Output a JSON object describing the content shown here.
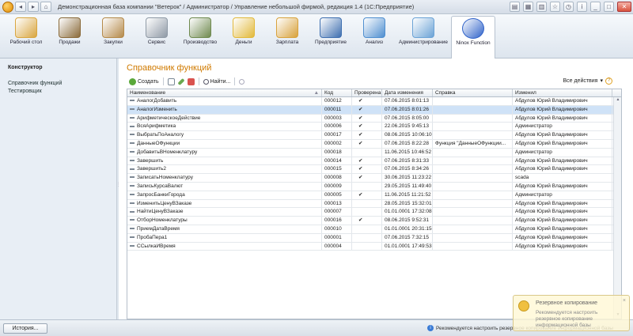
{
  "window": {
    "title": "Демонстрационная база компании \"Ветерок\" / Администратор / Управление небольшой фирмой, редакция 1.4  (1С:Предприятие)"
  },
  "sections": [
    {
      "label": "Рабочий стол",
      "icon": "desktop-icon",
      "color": "#d9a640"
    },
    {
      "label": "Продажи",
      "icon": "sales-icon",
      "color": "#8a6a3a"
    },
    {
      "label": "Закупки",
      "icon": "purchases-icon",
      "color": "#b58a4a"
    },
    {
      "label": "Сервис",
      "icon": "service-icon",
      "color": "#8f9aa6"
    },
    {
      "label": "Производство",
      "icon": "production-icon",
      "color": "#6f8a4f"
    },
    {
      "label": "Деньги",
      "icon": "money-icon",
      "color": "#e2b93b"
    },
    {
      "label": "Зарплата",
      "icon": "salary-icon",
      "color": "#d8a23c"
    },
    {
      "label": "Предприятие",
      "icon": "enterprise-icon",
      "color": "#3e6fb0"
    },
    {
      "label": "Анализ",
      "icon": "analysis-icon",
      "color": "#4f8fd0"
    },
    {
      "label": "Администрирование",
      "icon": "administration-icon",
      "color": "#6ba3d6"
    },
    {
      "label": "Ninox Function",
      "icon": "ninox-icon",
      "color": "#2f62c9"
    }
  ],
  "left_panel": {
    "heading": "Конструктор",
    "links": [
      "Справочник функций",
      "Тестировщик"
    ]
  },
  "form": {
    "title": "Справочник функций",
    "toolbar": {
      "create": "Создать",
      "find": "Найти...",
      "all_actions": "Все действия",
      "help": "?"
    },
    "columns": [
      "Наименование",
      "Код",
      "Проверена",
      "Дата изменения",
      "Справка",
      "Изменил"
    ],
    "rows": [
      {
        "name": "АналогДобавить",
        "code": "000012",
        "checked": "✔",
        "date": "07.06.2015 8:01:13",
        "help": "",
        "modified_by": "Абдулов Юрий Владимирович"
      },
      {
        "name": "АналогИзменить",
        "code": "000011",
        "checked": "✔",
        "date": "07.06.2015 8:01:26",
        "help": "",
        "modified_by": "Абдулов Юрий Владимирович"
      },
      {
        "name": "АрифметическоеДействие",
        "code": "000003",
        "checked": "✔",
        "date": "07.06.2015 8:05:00",
        "help": "",
        "modified_by": "Абдулов Юрий Владимирович"
      },
      {
        "name": "ВсяАрифметика",
        "code": "000006",
        "checked": "✔",
        "date": "22.06.2015 9:45:13",
        "help": "",
        "modified_by": "Администратор"
      },
      {
        "name": "ВыбратьПоАналогу",
        "code": "000017",
        "checked": "✔",
        "date": "08.06.2015 10:06:10",
        "help": "",
        "modified_by": "Абдулов Юрий Владимирович"
      },
      {
        "name": "ДанныеОФункции",
        "code": "000002",
        "checked": "✔",
        "date": "07.06.2015 8:22:28",
        "help": "Функция \"ДанныеОФункции...",
        "modified_by": "Абдулов Юрий Владимирович"
      },
      {
        "name": "ДобавитьВНоменклатуру",
        "code": "000018",
        "checked": "",
        "date": "11.06.2015 10:46:52",
        "help": "",
        "modified_by": "Администратор"
      },
      {
        "name": "Завершить",
        "code": "000014",
        "checked": "✔",
        "date": "07.06.2015 8:31:33",
        "help": "",
        "modified_by": "Абдулов Юрий Владимирович"
      },
      {
        "name": "Завершить2",
        "code": "000015",
        "checked": "✔",
        "date": "07.06.2015 8:34:26",
        "help": "",
        "modified_by": "Абдулов Юрий Владимирович"
      },
      {
        "name": "ЗаписатьНоменклатуру",
        "code": "000008",
        "checked": "✔",
        "date": "30.06.2015 11:23:22",
        "help": "",
        "modified_by": "scada"
      },
      {
        "name": "ЗаписьКурсаВалют",
        "code": "000009",
        "checked": "",
        "date": "29.05.2015 11:49:40",
        "help": "",
        "modified_by": "Абдулов Юрий Владимирович"
      },
      {
        "name": "ЗапросБанкиГорода",
        "code": "000005",
        "checked": "✔",
        "date": "11.06.2015 11:21:52",
        "help": "",
        "modified_by": "Администратор"
      },
      {
        "name": "ИзменитьЦенуВЗаказе",
        "code": "000013",
        "checked": "",
        "date": "28.05.2015 15:32:01",
        "help": "",
        "modified_by": "Абдулов Юрий Владимирович"
      },
      {
        "name": "НайтиЦенуВЗаказе",
        "code": "000007",
        "checked": "",
        "date": "01.01.0001 17:32:08",
        "help": "",
        "modified_by": "Абдулов Юрий Владимирович"
      },
      {
        "name": "ОтборНоменклатуры",
        "code": "000016",
        "checked": "✔",
        "date": "08.06.2015 9:52:31",
        "help": "",
        "modified_by": "Абдулов Юрий Владимирович"
      },
      {
        "name": "ПриемДатаВремя",
        "code": "000010",
        "checked": "",
        "date": "01.01.0001 20:31:15",
        "help": "",
        "modified_by": "Абдулов Юрий Владимирович"
      },
      {
        "name": "ПробаПера1",
        "code": "000001",
        "checked": "",
        "date": "07.06.2015 7:32:15",
        "help": "",
        "modified_by": "Абдулов Юрий Владимирович"
      },
      {
        "name": "ССылкаИВремя",
        "code": "000004",
        "checked": "",
        "date": "01.01.0001 17:49:53",
        "help": "",
        "modified_by": "Абдулов Юрий Владимирович"
      }
    ],
    "selected_row": 1
  },
  "status_bar": {
    "history": "История...",
    "message": "Рекомендуется настроить резервное копирование информационной базы"
  },
  "notification": {
    "title": "Резервное копирование",
    "text": "Рекомендуется настроить резервное копирование информационной базы",
    "close": "×"
  },
  "colors": {
    "title_accent": "#d07a00",
    "selection": "#cfe2f7"
  }
}
